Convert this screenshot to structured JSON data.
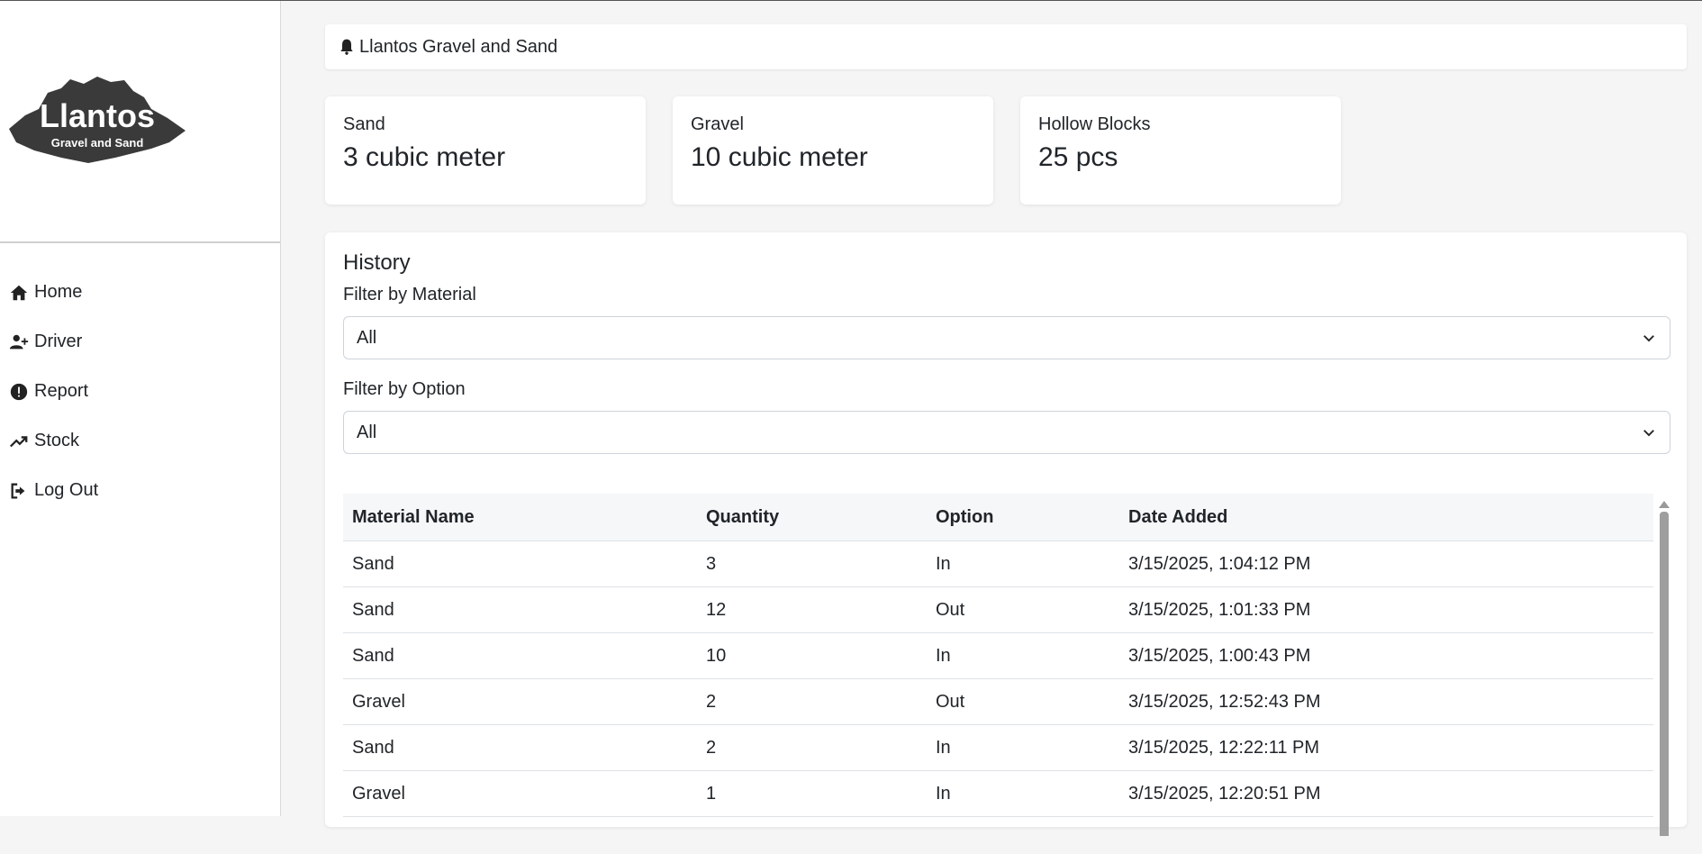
{
  "sidebar": {
    "logo": {
      "title": "Llantos",
      "subtitle": "Gravel and Sand"
    },
    "items": [
      {
        "label": "Home",
        "icon": "home-icon"
      },
      {
        "label": "Driver",
        "icon": "user-plus-icon"
      },
      {
        "label": "Report",
        "icon": "exclamation-circle-icon"
      },
      {
        "label": "Stock",
        "icon": "trend-up-icon"
      },
      {
        "label": "Log Out",
        "icon": "logout-icon"
      }
    ]
  },
  "header": {
    "title": "Llantos Gravel and Sand",
    "icon": "bell-icon"
  },
  "cards": [
    {
      "label": "Sand",
      "value": "3 cubic meter"
    },
    {
      "label": "Gravel",
      "value": "10 cubic meter"
    },
    {
      "label": "Hollow Blocks",
      "value": "25 pcs"
    }
  ],
  "history": {
    "title": "History",
    "filter_material": {
      "label": "Filter by Material",
      "value": "All"
    },
    "filter_option": {
      "label": "Filter by Option",
      "value": "All"
    },
    "columns": [
      "Material Name",
      "Quantity",
      "Option",
      "Date Added"
    ],
    "rows": [
      [
        "Sand",
        "3",
        "In",
        "3/15/2025, 1:04:12 PM"
      ],
      [
        "Sand",
        "12",
        "Out",
        "3/15/2025, 1:01:33 PM"
      ],
      [
        "Sand",
        "10",
        "In",
        "3/15/2025, 1:00:43 PM"
      ],
      [
        "Gravel",
        "2",
        "Out",
        "3/15/2025, 12:52:43 PM"
      ],
      [
        "Sand",
        "2",
        "In",
        "3/15/2025, 12:22:11 PM"
      ],
      [
        "Gravel",
        "1",
        "In",
        "3/15/2025, 12:20:51 PM"
      ]
    ]
  }
}
